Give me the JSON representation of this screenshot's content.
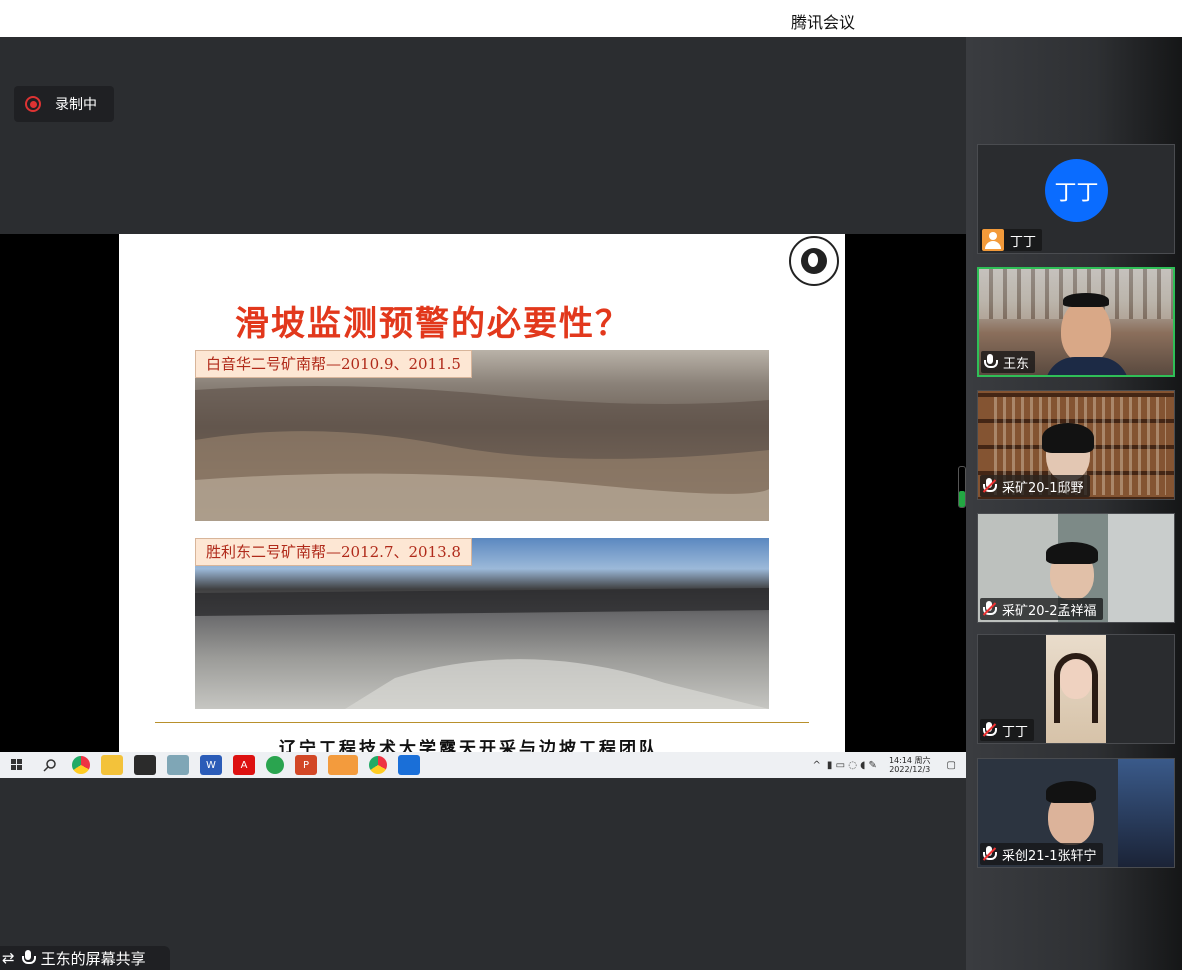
{
  "window": {
    "title": "腾讯会议"
  },
  "recording": {
    "label": "录制中"
  },
  "slide": {
    "title": "滑坡监测预警的必要性？",
    "photo1_caption": "白音华二号矿南帮—2010.9、2011.5",
    "photo2_caption": "胜利东二号矿南帮—2012.7、2013.8",
    "footer": "辽宁工程技术大学露天开采与边坡工程团队"
  },
  "taskbar": {
    "icons": [
      "windows-icon",
      "search-icon",
      "chrome-icon",
      "file-explorer-icon",
      "sticky-notes-icon",
      "notes-icon",
      "word-icon",
      "acrobat-icon",
      "edge-icon",
      "powerpoint-icon",
      "wechat-icon",
      "chrome-icon",
      "app-icon"
    ],
    "clock_time": "14:14 周六",
    "clock_date": "2022/12/3"
  },
  "share_label": "王东的屏幕共享",
  "participants": [
    {
      "name": "丁丁",
      "avatar_text": "丁丁",
      "status": "no-mic"
    },
    {
      "name": "王东",
      "status": "mic-on"
    },
    {
      "name": "采矿20-1邸野",
      "status": "muted"
    },
    {
      "name": "采矿20-2孟祥福",
      "status": "muted"
    },
    {
      "name": "丁丁",
      "status": "muted"
    },
    {
      "name": "采创21-1张轩宁",
      "status": "muted"
    }
  ],
  "colors": {
    "accent_green": "#2fbf57",
    "avatar_blue": "#0a6cff",
    "slide_title_red": "#e2381c"
  }
}
